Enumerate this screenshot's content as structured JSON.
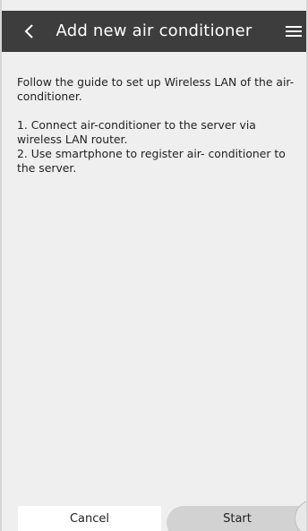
{
  "header": {
    "title": "Add new air conditioner",
    "back_icon": "chevron-left-icon",
    "menu_icon": "hamburger-menu-icon"
  },
  "content": {
    "intro": "Follow the guide to set up Wireless LAN of the air-conditioner.",
    "steps": [
      "1. Connect air-conditioner to the server via  wireless LAN router.",
      "2. Use smartphone to register air- conditioner to the server."
    ]
  },
  "footer": {
    "cancel_label": "Cancel",
    "start_label": "Start"
  },
  "colors": {
    "header_bg": "#3d3d3d",
    "background": "#efefef",
    "start_button_bg": "#d2d2d2"
  }
}
